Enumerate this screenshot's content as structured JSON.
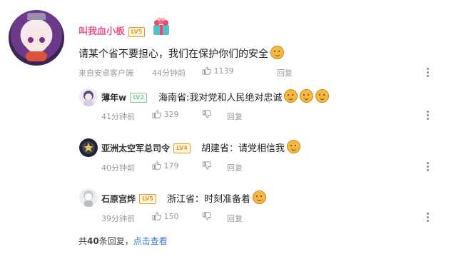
{
  "main_comment": {
    "username": "叫我血小板",
    "level": "LV5",
    "text": "请某个省不要担心，我们在保护你们的安全",
    "source": "来自安卓客户端",
    "time": "44分钟前",
    "likes": "1139",
    "reply_label": "回复",
    "avatar_icon": "anime-girl-avatar",
    "decoration_icon": "gift-box-icon"
  },
  "replies": [
    {
      "username": "薄年w",
      "level": "LV2",
      "text": "海南省:我对党和人民绝对忠诚",
      "time": "41分钟前",
      "likes": "329",
      "reply_label": "回复"
    },
    {
      "username": "亚洲太空军总司令",
      "level": "LV4",
      "text": "胡建省：请党相信我",
      "time": "40分钟前",
      "likes": "179",
      "reply_label": "回复"
    },
    {
      "username": "石原宫烨",
      "level": "LV5",
      "text": "浙江省：时刻准备着",
      "time": "39分钟前",
      "likes": "150",
      "reply_label": "回复"
    }
  ],
  "footer": {
    "prefix": "共",
    "count": "40",
    "suffix": "条回复，",
    "link": "点击查看"
  },
  "colors": {
    "username_pink": "#e8568e",
    "level_orange": "#f39a1e",
    "level_green": "#8cc9a0",
    "link_blue": "#3a78c8",
    "meta_gray": "#9a9a9a"
  }
}
